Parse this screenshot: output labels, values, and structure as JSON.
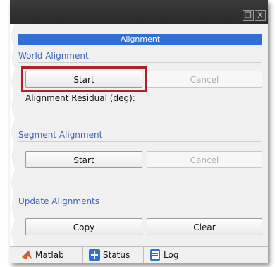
{
  "window": {
    "restore_glyph": "❐",
    "close_glyph": "X"
  },
  "header": {
    "title": "Alignment"
  },
  "world_alignment": {
    "title": "World Alignment",
    "start_label": "Start",
    "cancel_label": "Cancel",
    "residual_label": "Alignment Residual (deg):"
  },
  "segment_alignment": {
    "title": "Segment Alignment",
    "start_label": "Start",
    "cancel_label": "Cancel"
  },
  "update_alignments": {
    "title": "Update Alignments",
    "copy_label": "Copy",
    "clear_label": "Clear"
  },
  "tabs": [
    {
      "label": "Matlab",
      "icon": "matlab-icon"
    },
    {
      "label": "Status",
      "icon": "status-plus-icon"
    },
    {
      "label": "Log",
      "icon": "log-file-icon"
    }
  ],
  "colors": {
    "accent": "#2f6fd6",
    "section_title": "#3b63b8",
    "highlight": "#b0202a"
  }
}
